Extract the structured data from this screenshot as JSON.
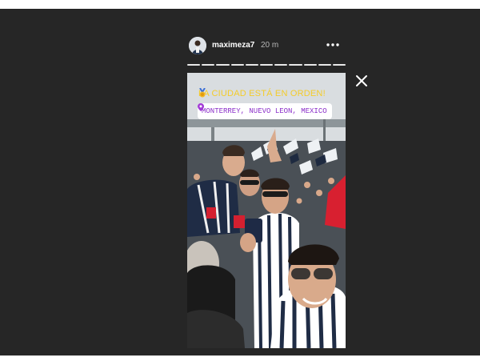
{
  "story": {
    "username": "maximeza7",
    "time": "20 m",
    "segments": 11
  },
  "sticker": {
    "caption": "LA CIUDAD ESTÁ EN ORDEN!",
    "location": "MONTERREY, NUEVO LEON, MEXICO"
  },
  "colors": {
    "viewer_bg": "#262626",
    "caption": "#f4cc2a",
    "location_text": "#8b2fc9"
  },
  "icons": {
    "more": "more-options-icon",
    "close": "close-icon",
    "location": "location-pin-icon",
    "medal": "medal-emoji-icon"
  }
}
